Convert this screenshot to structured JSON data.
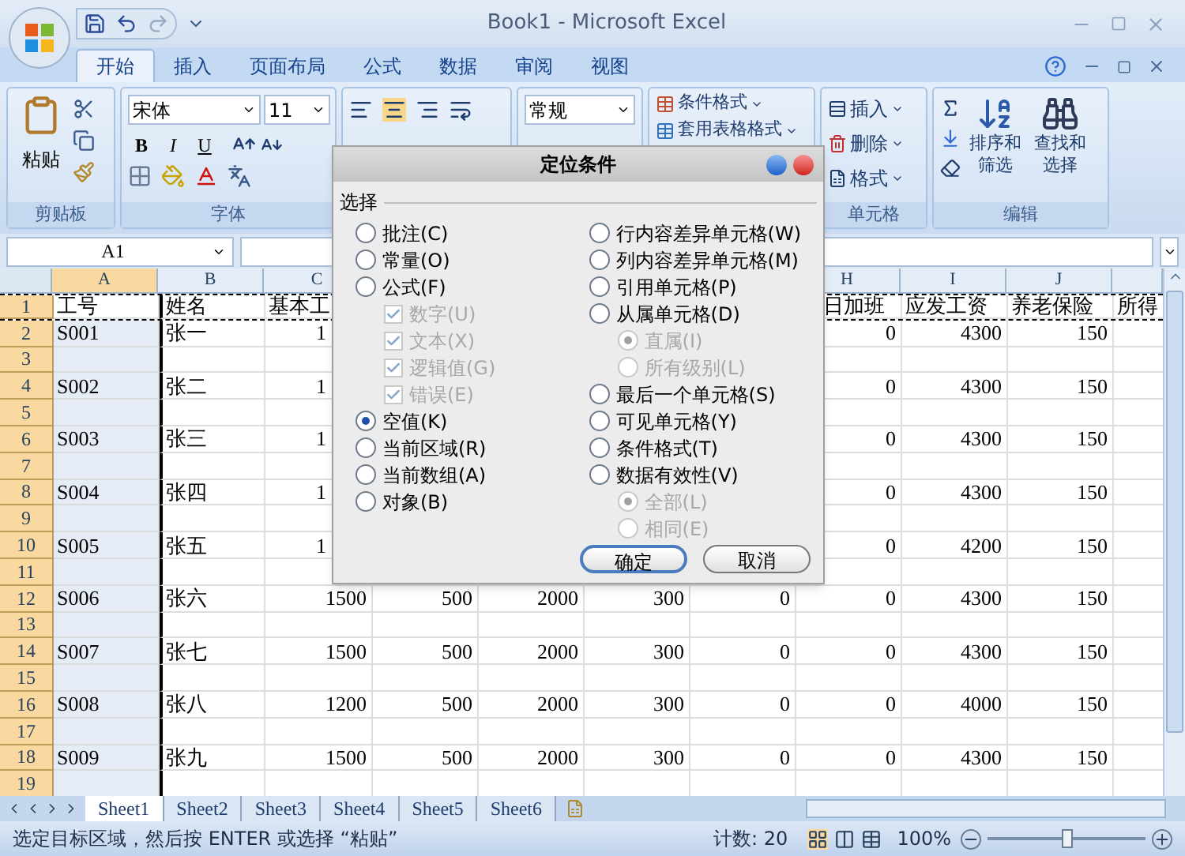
{
  "window": {
    "title": "Book1 - Microsoft Excel"
  },
  "ribbon": {
    "tabs": [
      {
        "label": "开始",
        "selected": true
      },
      {
        "label": "插入",
        "selected": false
      },
      {
        "label": "页面布局",
        "selected": false
      },
      {
        "label": "公式",
        "selected": false
      },
      {
        "label": "数据",
        "selected": false
      },
      {
        "label": "审阅",
        "selected": false
      },
      {
        "label": "视图",
        "selected": false
      }
    ],
    "clipboard": {
      "paste": "粘贴",
      "label": "剪贴板"
    },
    "font": {
      "name": "宋体",
      "size": "11",
      "bold": "B",
      "italic": "I",
      "underline": "U",
      "label": "字体"
    },
    "number": {
      "format": "常规"
    },
    "styles": {
      "conditional": "条件格式",
      "table": "套用表格格式"
    },
    "cells": {
      "insert": "插入",
      "delete": "删除",
      "format": "格式",
      "label": "单元格"
    },
    "editing": {
      "sort": "排序和筛选",
      "find": "查找和选择",
      "label": "编辑"
    }
  },
  "formula_bar": {
    "name_box": "A1"
  },
  "sheet": {
    "columns": [
      {
        "label": "A",
        "selected": true
      },
      {
        "label": "B",
        "selected": false
      },
      {
        "label": "C",
        "selected": false
      },
      {
        "label": "H",
        "selected": false
      },
      {
        "label": "I",
        "selected": false
      },
      {
        "label": "J",
        "selected": false
      }
    ],
    "rows": [
      {
        "number": "1",
        "cells": [
          "工号",
          "姓名",
          "基本工",
          null,
          null,
          null,
          null,
          "日加班",
          "应发工资",
          "养老保险",
          "所得"
        ]
      },
      {
        "number": "2",
        "covered": true,
        "cells": [
          "S001",
          "张一",
          "1",
          null,
          null,
          null,
          null,
          "0",
          "4300",
          "150",
          null
        ]
      },
      {
        "number": "3",
        "covered": true
      },
      {
        "number": "4",
        "covered": true,
        "cells": [
          "S002",
          "张二",
          "1",
          null,
          null,
          null,
          null,
          "0",
          "4300",
          "150",
          null
        ]
      },
      {
        "number": "5",
        "covered": true
      },
      {
        "number": "6",
        "covered": true,
        "cells": [
          "S003",
          "张三",
          "1",
          null,
          null,
          null,
          null,
          "0",
          "4300",
          "150",
          null
        ]
      },
      {
        "number": "7",
        "covered": true
      },
      {
        "number": "8",
        "covered": true,
        "cells": [
          "S004",
          "张四",
          "1",
          null,
          null,
          null,
          null,
          "0",
          "4300",
          "150",
          null
        ]
      },
      {
        "number": "9",
        "covered": true
      },
      {
        "number": "10",
        "covered": true,
        "cells": [
          "S005",
          "张五",
          "1",
          null,
          null,
          null,
          null,
          "0",
          "4200",
          "150",
          null
        ]
      },
      {
        "number": "11",
        "covered": true
      },
      {
        "number": "12",
        "covered": false,
        "cells": [
          "S006",
          "张六",
          "1500",
          "500",
          "2000",
          "300",
          "0",
          "0",
          "4300",
          "150",
          null
        ]
      },
      {
        "number": "13",
        "covered": false
      },
      {
        "number": "14",
        "covered": false,
        "cells": [
          "S007",
          "张七",
          "1500",
          "500",
          "2000",
          "300",
          "0",
          "0",
          "4300",
          "150",
          null
        ]
      },
      {
        "number": "15",
        "covered": false
      },
      {
        "number": "16",
        "covered": false,
        "cells": [
          "S008",
          "张八",
          "1200",
          "500",
          "2000",
          "300",
          "0",
          "0",
          "4000",
          "150",
          null
        ]
      },
      {
        "number": "17",
        "covered": false
      },
      {
        "number": "18",
        "covered": false,
        "cells": [
          "S009",
          "张九",
          "1500",
          "500",
          "2000",
          "300",
          "0",
          "0",
          "4300",
          "150",
          null
        ]
      },
      {
        "number": "19",
        "covered": false
      }
    ],
    "tabs": [
      {
        "label": "Sheet1",
        "selected": true
      },
      {
        "label": "Sheet2",
        "selected": false
      },
      {
        "label": "Sheet3",
        "selected": false
      },
      {
        "label": "Sheet4",
        "selected": false
      },
      {
        "label": "Sheet5",
        "selected": false
      },
      {
        "label": "Sheet6",
        "selected": false
      }
    ]
  },
  "status_bar": {
    "message": "选定目标区域，然后按 ENTER 或选择 “粘贴”",
    "count": "计数: 20",
    "zoom": "100%",
    "zoom_slider": {
      "level": 0.5
    }
  },
  "dialog": {
    "title": "定位条件",
    "group": "选择",
    "left": [
      {
        "label": "批注(C)",
        "kind": "radio",
        "selected": false,
        "disabled": false
      },
      {
        "label": "常量(O)",
        "kind": "radio",
        "selected": false,
        "disabled": false
      },
      {
        "label": "公式(F)",
        "kind": "radio",
        "selected": false,
        "disabled": false,
        "children": [
          {
            "label": "数字(U)",
            "kind": "checkbox",
            "checked": true,
            "disabled": true
          },
          {
            "label": "文本(X)",
            "kind": "checkbox",
            "checked": true,
            "disabled": true
          },
          {
            "label": "逻辑值(G)",
            "kind": "checkbox",
            "checked": true,
            "disabled": true
          },
          {
            "label": "错误(E)",
            "kind": "checkbox",
            "checked": true,
            "disabled": true
          }
        ]
      },
      {
        "label": "空值(K)",
        "kind": "radio",
        "selected": true,
        "disabled": false
      },
      {
        "label": "当前区域(R)",
        "kind": "radio",
        "selected": false,
        "disabled": false
      },
      {
        "label": "当前数组(A)",
        "kind": "radio",
        "selected": false,
        "disabled": false
      },
      {
        "label": "对象(B)",
        "kind": "radio",
        "selected": false,
        "disabled": false
      }
    ],
    "right": [
      {
        "label": "行内容差异单元格(W)",
        "kind": "radio",
        "selected": false,
        "disabled": false
      },
      {
        "label": "列内容差异单元格(M)",
        "kind": "radio",
        "selected": false,
        "disabled": false
      },
      {
        "label": "引用单元格(P)",
        "kind": "radio",
        "selected": false,
        "disabled": false
      },
      {
        "label": "从属单元格(D)",
        "kind": "radio",
        "selected": false,
        "disabled": false,
        "children": [
          {
            "label": "直属(I)",
            "kind": "radio",
            "selected": true,
            "disabled": true
          },
          {
            "label": "所有级别(L)",
            "kind": "radio",
            "selected": false,
            "disabled": true
          }
        ]
      },
      {
        "label": "最后一个单元格(S)",
        "kind": "radio",
        "selected": false,
        "disabled": false
      },
      {
        "label": "可见单元格(Y)",
        "kind": "radio",
        "selected": false,
        "disabled": false
      },
      {
        "label": "条件格式(T)",
        "kind": "radio",
        "selected": false,
        "disabled": false
      },
      {
        "label": "数据有效性(V)",
        "kind": "radio",
        "selected": false,
        "disabled": false,
        "children": [
          {
            "label": "全部(L)",
            "kind": "radio",
            "selected": true,
            "disabled": true
          },
          {
            "label": "相同(E)",
            "kind": "radio",
            "selected": false,
            "disabled": true
          }
        ]
      }
    ],
    "buttons": [
      {
        "label": "确定",
        "kind": "default"
      },
      {
        "label": "取消",
        "kind": "normal"
      }
    ]
  }
}
